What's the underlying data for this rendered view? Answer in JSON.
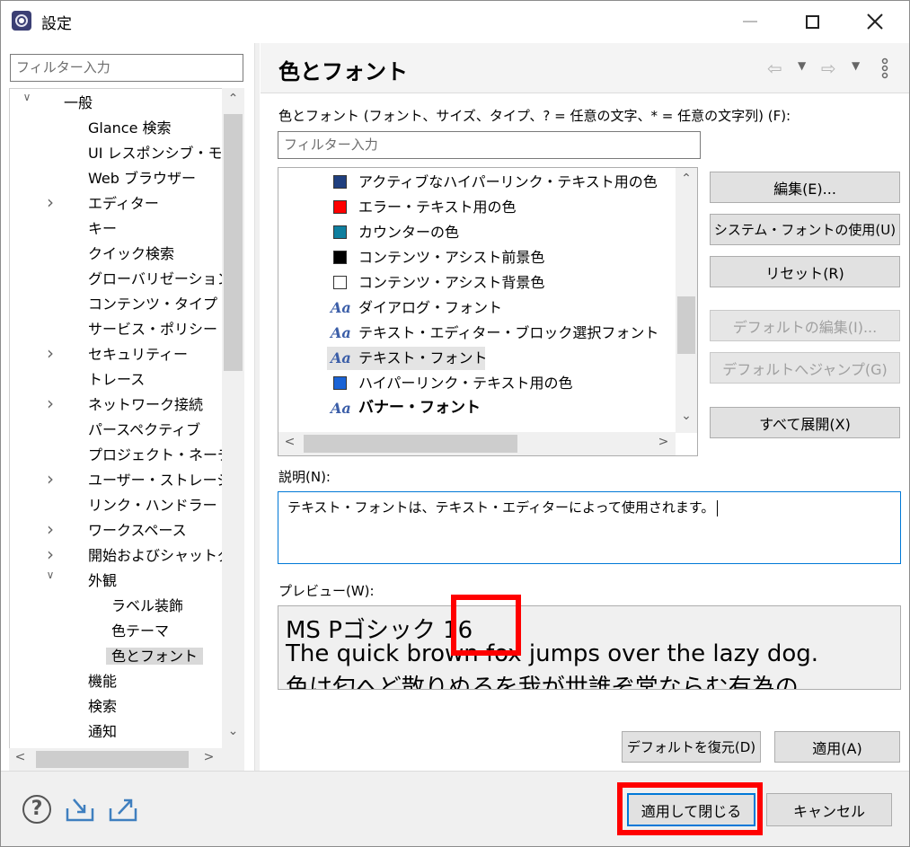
{
  "window": {
    "title": "設定"
  },
  "left": {
    "filter_placeholder": "フィルター入力",
    "tree": [
      {
        "label": "一般",
        "level": 0,
        "chevron": "down"
      },
      {
        "label": "Glance 検索",
        "level": 1,
        "chevron": ""
      },
      {
        "label": "UI レスポンシブ・モニター",
        "level": 1,
        "chevron": ""
      },
      {
        "label": "Web ブラウザー",
        "level": 1,
        "chevron": ""
      },
      {
        "label": "エディター",
        "level": 1,
        "chevron": "right"
      },
      {
        "label": "キー",
        "level": 1,
        "chevron": ""
      },
      {
        "label": "クイック検索",
        "level": 1,
        "chevron": ""
      },
      {
        "label": "グローバリゼーション",
        "level": 1,
        "chevron": ""
      },
      {
        "label": "コンテンツ・タイプ",
        "level": 1,
        "chevron": ""
      },
      {
        "label": "サービス・ポリシー",
        "level": 1,
        "chevron": ""
      },
      {
        "label": "セキュリティー",
        "level": 1,
        "chevron": "right"
      },
      {
        "label": "トレース",
        "level": 1,
        "chevron": ""
      },
      {
        "label": "ネットワーク接続",
        "level": 1,
        "chevron": "right"
      },
      {
        "label": "パースペクティブ",
        "level": 1,
        "chevron": ""
      },
      {
        "label": "プロジェクト・ネーチャー",
        "level": 1,
        "chevron": ""
      },
      {
        "label": "ユーザー・ストレージ・サー",
        "level": 1,
        "chevron": "right"
      },
      {
        "label": "リンク・ハンドラー",
        "level": 1,
        "chevron": ""
      },
      {
        "label": "ワークスペース",
        "level": 1,
        "chevron": "right"
      },
      {
        "label": "開始およびシャットダウン",
        "level": 1,
        "chevron": "right"
      },
      {
        "label": "外観",
        "level": 1,
        "chevron": "down"
      },
      {
        "label": "ラベル装飾",
        "level": 2,
        "chevron": ""
      },
      {
        "label": "色テーマ",
        "level": 2,
        "chevron": ""
      },
      {
        "label": "色とフォント",
        "level": 2,
        "chevron": "",
        "selected": true
      },
      {
        "label": "機能",
        "level": 1,
        "chevron": ""
      },
      {
        "label": "検索",
        "level": 1,
        "chevron": ""
      },
      {
        "label": "通知",
        "level": 1,
        "chevron": ""
      }
    ]
  },
  "right": {
    "page_title": "色とフォント",
    "section_label": "色とフォント (フォント、サイズ、タイプ、? = 任意の文字、* = 任意の文字列) (F):",
    "filter_placeholder": "フィルター入力",
    "list": [
      {
        "label": "アクティブなハイパーリンク・テキスト用の色",
        "kind": "color",
        "color": "#1f3f7f"
      },
      {
        "label": "エラー・テキスト用の色",
        "kind": "color",
        "color": "#ff0000"
      },
      {
        "label": "カウンターの色",
        "kind": "color",
        "color": "#0f7f9f"
      },
      {
        "label": "コンテンツ・アシスト前景色",
        "kind": "color",
        "color": "#000000"
      },
      {
        "label": "コンテンツ・アシスト背景色",
        "kind": "color",
        "color": "#ffffff"
      },
      {
        "label": "ダイアログ・フォント",
        "kind": "font",
        "icon": "Aa"
      },
      {
        "label": "テキスト・エディター・ブロック選択フォント",
        "kind": "font",
        "icon": "Aa"
      },
      {
        "label": "テキスト・フォント",
        "kind": "font",
        "icon": "Aa",
        "selected": true
      },
      {
        "label": "ハイパーリンク・テキスト用の色",
        "kind": "color",
        "color": "#1a63d6"
      },
      {
        "label": "バナー・フォント",
        "kind": "font",
        "icon": "Aa",
        "bold": true
      }
    ],
    "buttons": {
      "edit": "編集(E)...",
      "system_font": "システム・フォントの使用(U)",
      "reset": "リセット(R)",
      "edit_default": "デフォルトの編集(I)...",
      "goto_default": "デフォルトへジャンプ(G)",
      "expand_all": "すべて展開(X)"
    },
    "description_label": "説明(N):",
    "description_text": "テキスト・フォントは、テキスト・エディターによって使用されます。",
    "preview_label": "プレビュー(W):",
    "preview_lines": [
      "MS Pゴシック 16",
      "The quick brown fox jumps over the lazy dog.",
      "色は匂へど散りぬるを我が世誰ぞ常ならむ有為の"
    ],
    "restore_default": "デフォルトを復元(D)",
    "apply": "適用(A)"
  },
  "footer": {
    "apply_close": "適用して閉じる",
    "cancel": "キャンセル"
  },
  "colors": {
    "accent": "#0078d7",
    "highlight_box": "#ff0000"
  }
}
